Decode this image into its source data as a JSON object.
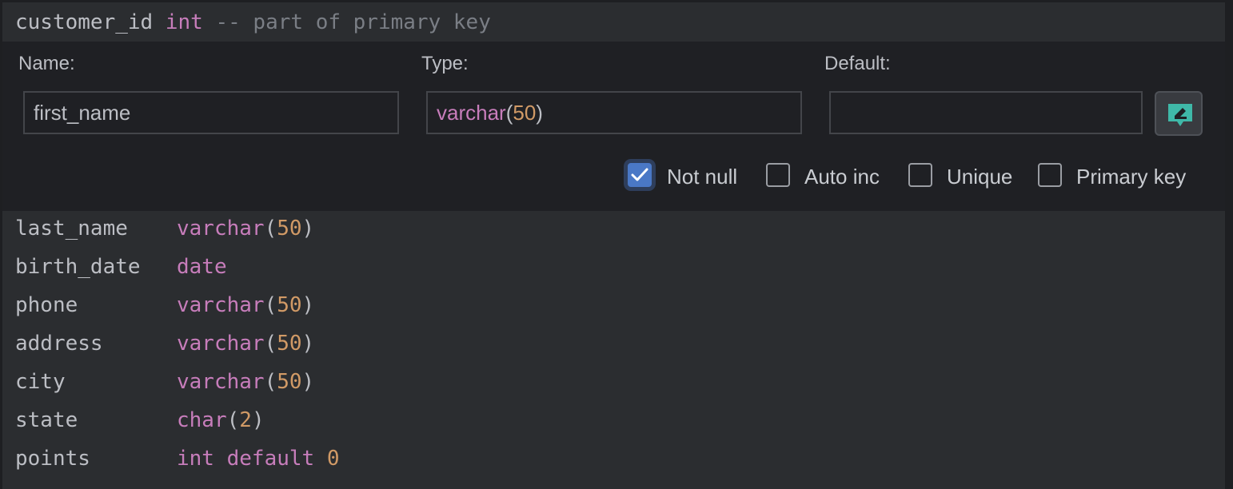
{
  "header": {
    "column_name": "customer_id",
    "column_type": "int",
    "comment": "-- part of primary key"
  },
  "editor": {
    "name_label": "Name:",
    "name_value": "first_name",
    "type_label": "Type:",
    "type_keyword": "varchar",
    "type_open": "(",
    "type_arg": "50",
    "type_close": ")",
    "default_label": "Default:",
    "default_value": "",
    "edit_button_icon": "edit-comment-icon",
    "checkboxes": [
      {
        "label": "Not null",
        "checked": true
      },
      {
        "label": "Auto inc",
        "checked": false
      },
      {
        "label": "Unique",
        "checked": false
      },
      {
        "label": "Primary key",
        "checked": false
      }
    ]
  },
  "columns": [
    {
      "name": "last_name",
      "type_kw": "varchar",
      "open": "(",
      "arg": "50",
      "close": ")"
    },
    {
      "name": "birth_date",
      "type_kw": "date",
      "open": "",
      "arg": "",
      "close": ""
    },
    {
      "name": "phone",
      "type_kw": "varchar",
      "open": "(",
      "arg": "50",
      "close": ")"
    },
    {
      "name": "address",
      "type_kw": "varchar",
      "open": "(",
      "arg": "50",
      "close": ")"
    },
    {
      "name": "city",
      "type_kw": "varchar",
      "open": "(",
      "arg": "50",
      "close": ")"
    },
    {
      "name": "state",
      "type_kw": "char",
      "open": "(",
      "arg": "2",
      "close": ")"
    },
    {
      "name": "points",
      "type_kw": "int default",
      "open": " ",
      "arg": "0",
      "close": ""
    }
  ],
  "colors": {
    "keyword": "#c77dbb",
    "number": "#d19a66",
    "accent": "#4a78c6",
    "edit_icon": "#3fb8a8"
  }
}
